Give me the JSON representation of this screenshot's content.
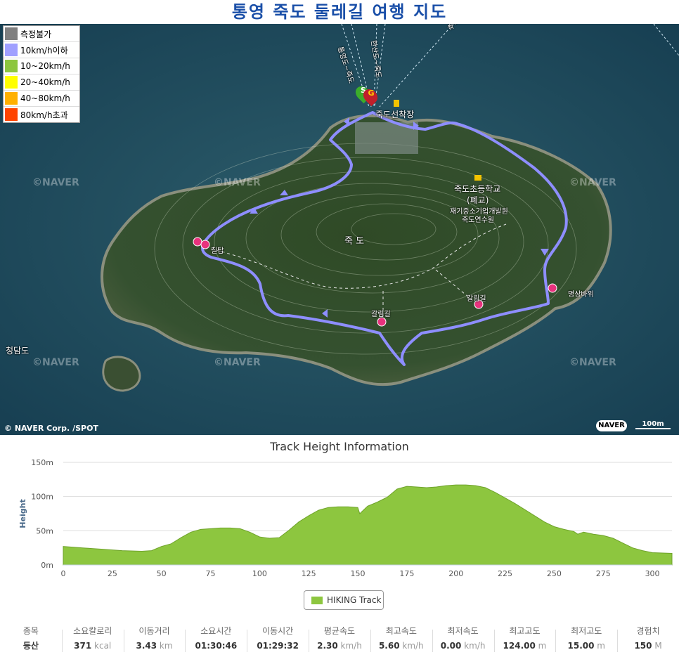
{
  "title": "통영 죽도 둘레길 여행 지도",
  "legend": [
    {
      "label": "측정불가",
      "color": "#808080"
    },
    {
      "label": "10km/h이하",
      "color": "#a0a0ff"
    },
    {
      "label": "10~20km/h",
      "color": "#8dc63f"
    },
    {
      "label": "20~40km/h",
      "color": "#ffff00"
    },
    {
      "label": "40~80km/h",
      "color": "#ffb000"
    },
    {
      "label": "80km/h초과",
      "color": "#ff4400"
    }
  ],
  "map_labels": {
    "port": "죽도선착장",
    "school": "죽도초등학교",
    "school_note": "(폐교)",
    "center_line1": "재기중소기업개발원",
    "center_line2": "죽도연수원",
    "island": "죽 도",
    "tower": "칠탑",
    "fork1": "갈림길",
    "fork2": "갈림길",
    "rock": "명상바위",
    "west_island": "청담도",
    "ferry1": "통영도~죽도",
    "ferry2": "한산도~죽도",
    "ferry3": "추봉도~죽도",
    "start_marker": "S",
    "goal_marker": "G"
  },
  "watermark": "©NAVER",
  "copyright": "© NAVER Corp. /SPOT",
  "naver_logo": "NAVER",
  "scale_label": "100m",
  "chart_data": {
    "type": "area",
    "title": "Track Height Information",
    "ylabel": "Height",
    "xlabel": "",
    "xlim": [
      0,
      310
    ],
    "ylim": [
      0,
      150
    ],
    "xticks": [
      0,
      25,
      50,
      75,
      100,
      125,
      150,
      175,
      200,
      225,
      250,
      275,
      300
    ],
    "yticks": [
      "0m",
      "50m",
      "100m",
      "150m"
    ],
    "series": [
      {
        "name": "HIKING Track",
        "color": "#8dc63f",
        "x": [
          0,
          10,
          20,
          30,
          40,
          45,
          50,
          55,
          60,
          65,
          70,
          75,
          80,
          85,
          90,
          95,
          100,
          105,
          110,
          115,
          120,
          125,
          130,
          135,
          140,
          145,
          150,
          151,
          155,
          160,
          165,
          170,
          175,
          180,
          185,
          190,
          195,
          200,
          205,
          210,
          215,
          220,
          225,
          230,
          235,
          240,
          245,
          250,
          255,
          260,
          262,
          265,
          270,
          275,
          280,
          285,
          290,
          295,
          300,
          310
        ],
        "y": [
          27,
          25,
          23,
          21,
          20,
          21,
          27,
          31,
          40,
          48,
          52,
          53,
          54,
          54,
          53,
          48,
          41,
          39,
          40,
          51,
          63,
          72,
          80,
          84,
          85,
          85,
          84,
          75,
          86,
          92,
          99,
          111,
          115,
          114,
          113,
          114,
          116,
          117,
          117,
          116,
          113,
          106,
          98,
          90,
          81,
          72,
          63,
          56,
          52,
          49,
          45,
          48,
          45,
          43,
          39,
          32,
          25,
          21,
          18,
          17
        ]
      }
    ]
  },
  "stats": [
    {
      "label": "종목",
      "value": "등산",
      "unit": ""
    },
    {
      "label": "소요칼로리",
      "value": "371",
      "unit": "kcal"
    },
    {
      "label": "이동거리",
      "value": "3.43",
      "unit": "km"
    },
    {
      "label": "소요시간",
      "value": "01:30:46",
      "unit": ""
    },
    {
      "label": "이동시간",
      "value": "01:29:32",
      "unit": ""
    },
    {
      "label": "평균속도",
      "value": "2.30",
      "unit": "km/h"
    },
    {
      "label": "최고속도",
      "value": "5.60",
      "unit": "km/h"
    },
    {
      "label": "최저속도",
      "value": "0.00",
      "unit": "km/h"
    },
    {
      "label": "최고고도",
      "value": "124.00",
      "unit": "m"
    },
    {
      "label": "최저고도",
      "value": "15.00",
      "unit": "m"
    },
    {
      "label": "경험치",
      "value": "150",
      "unit": "M"
    }
  ]
}
